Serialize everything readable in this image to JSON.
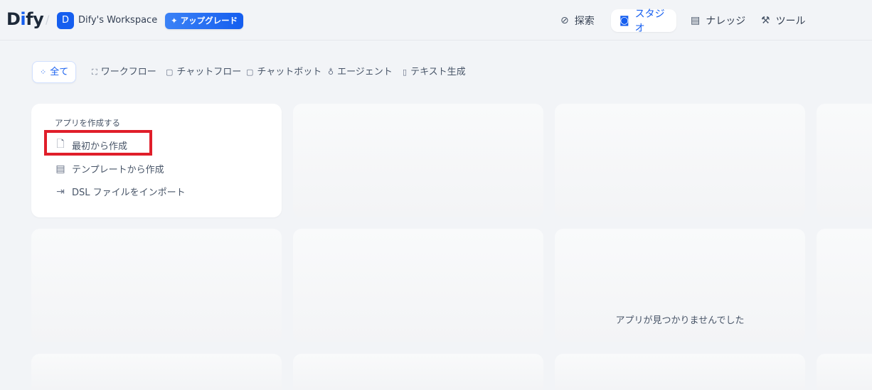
{
  "header": {
    "logo_d": "D",
    "logo_i": "i",
    "logo_rest": "fy",
    "workspace_initial": "D",
    "workspace_name": "Dify's Workspace",
    "upgrade_label": "アップグレード",
    "nav": {
      "explore": "探索",
      "studio": "スタジオ",
      "knowledge": "ナレッジ",
      "tools": "ツール"
    }
  },
  "tabs": {
    "all": "全て",
    "workflow": "ワークフロー",
    "chatflow": "チャットフロー",
    "chatbot": "チャットボット",
    "agent": "エージェント",
    "text_gen": "テキスト生成"
  },
  "create_card": {
    "title": "アプリを作成する",
    "from_blank": "最初から作成",
    "from_template": "テンプレートから作成",
    "import_dsl": "DSL ファイルをインポート"
  },
  "empty_message": "アプリが見つかりませんでした",
  "colors": {
    "accent": "#155eef",
    "highlight": "#e01e2a",
    "background": "#f2f4f7"
  }
}
